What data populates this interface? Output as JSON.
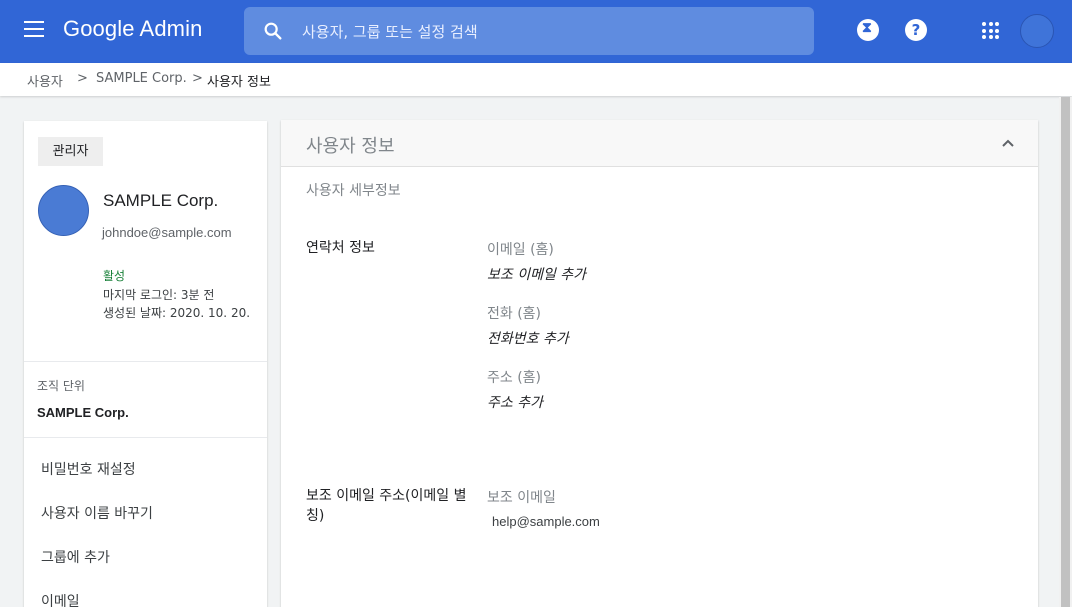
{
  "header": {
    "brand": "Google Admin",
    "search_placeholder": "사용자, 그룹 또는 설정 검색",
    "help_glyph": "?",
    "colors": {
      "bar": "#3166d6",
      "search": "#5f8ce0"
    }
  },
  "breadcrumb": {
    "items": [
      "사용자",
      "SAMPLE Corp.",
      "사용자 정보"
    ],
    "separator": ">"
  },
  "profile": {
    "role_chip": "관리자",
    "name": "SAMPLE Corp.",
    "email": "johndoe@sample.com",
    "status": "활성",
    "last_login": "마지막 로그인: 3분 전",
    "created": "생성된 날짜: 2020. 10. 20.",
    "org_unit_label": "조직 단위",
    "org_unit_value": "SAMPLE Corp.",
    "actions": [
      "비밀번호 재설정",
      "사용자 이름 바꾸기",
      "그룹에 추가",
      "이메일"
    ]
  },
  "main": {
    "title": "사용자 정보",
    "subtitle": "사용자 세부정보",
    "contact": {
      "label": "연락처 정보",
      "fields": [
        {
          "label": "이메일 (홈)",
          "action": "보조 이메일 추가"
        },
        {
          "label": "전화 (홈)",
          "action": "전화번호 추가"
        },
        {
          "label": "주소 (홈)",
          "action": "주소 추가"
        }
      ]
    },
    "alternate": {
      "label": "보조 이메일 주소(이메일 별칭)",
      "field_label": "보조 이메일",
      "value": "help@sample.com"
    }
  }
}
